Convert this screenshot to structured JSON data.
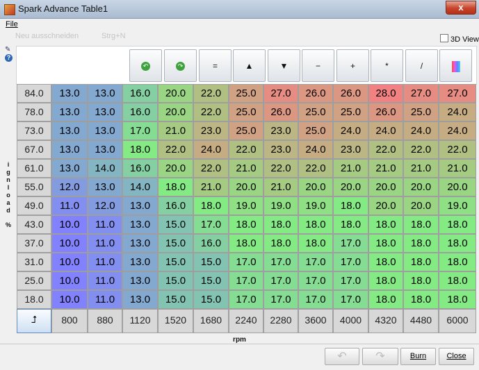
{
  "window": {
    "title": "Spark Advance Table1",
    "close_label": "x"
  },
  "menu": {
    "file": "File"
  },
  "command_bar": {
    "cut": "Neu ausschneiden",
    "cut_shortcut": "Strg+N",
    "view_3d": "3D View"
  },
  "toolbar": {
    "buttons": [
      {
        "name": "undo-icon",
        "glyph": "↶"
      },
      {
        "name": "redo-icon",
        "glyph": "↷"
      },
      {
        "name": "set-equal-icon",
        "glyph": "="
      },
      {
        "name": "increase-icon",
        "glyph": "▲"
      },
      {
        "name": "decrease-icon",
        "glyph": "▼"
      },
      {
        "name": "minus-icon",
        "glyph": "−"
      },
      {
        "name": "plus-icon",
        "glyph": "+"
      },
      {
        "name": "multiply-icon",
        "glyph": "*"
      },
      {
        "name": "interpolate-icon",
        "glyph": "/"
      },
      {
        "name": "color-palette-icon",
        "glyph": "▐"
      }
    ]
  },
  "y_axis": {
    "label_chars": [
      "i",
      "g",
      "n",
      "l",
      "o",
      "a",
      "d",
      "%"
    ]
  },
  "row_headers": [
    "84.0",
    "78.0",
    "73.0",
    "67.0",
    "61.0",
    "55.0",
    "49.0",
    "43.0",
    "37.0",
    "31.0",
    "25.0",
    "18.0"
  ],
  "col_headers": [
    "800",
    "880",
    "1120",
    "1520",
    "1680",
    "2240",
    "2280",
    "3600",
    "4000",
    "4320",
    "4480",
    "6000"
  ],
  "cells": [
    [
      "13.0",
      "13.0",
      "16.0",
      "20.0",
      "22.0",
      "25.0",
      "27.0",
      "26.0",
      "26.0",
      "28.0",
      "27.0",
      "27.0"
    ],
    [
      "13.0",
      "13.0",
      "16.0",
      "20.0",
      "22.0",
      "25.0",
      "26.0",
      "25.0",
      "25.0",
      "26.0",
      "25.0",
      "24.0"
    ],
    [
      "13.0",
      "13.0",
      "17.0",
      "21.0",
      "23.0",
      "25.0",
      "23.0",
      "25.0",
      "24.0",
      "24.0",
      "24.0",
      "24.0"
    ],
    [
      "13.0",
      "13.0",
      "18.0",
      "22.0",
      "24.0",
      "22.0",
      "23.0",
      "24.0",
      "23.0",
      "22.0",
      "22.0",
      "22.0"
    ],
    [
      "13.0",
      "14.0",
      "16.0",
      "20.0",
      "22.0",
      "21.0",
      "22.0",
      "22.0",
      "21.0",
      "21.0",
      "21.0",
      "21.0"
    ],
    [
      "12.0",
      "13.0",
      "14.0",
      "18.0",
      "21.0",
      "20.0",
      "21.0",
      "20.0",
      "20.0",
      "20.0",
      "20.0",
      "20.0"
    ],
    [
      "11.0",
      "12.0",
      "13.0",
      "16.0",
      "18.0",
      "19.0",
      "19.0",
      "19.0",
      "18.0",
      "20.0",
      "20.0",
      "19.0"
    ],
    [
      "10.0",
      "11.0",
      "13.0",
      "15.0",
      "17.0",
      "18.0",
      "18.0",
      "18.0",
      "18.0",
      "18.0",
      "18.0",
      "18.0"
    ],
    [
      "10.0",
      "11.0",
      "13.0",
      "15.0",
      "16.0",
      "18.0",
      "18.0",
      "18.0",
      "17.0",
      "18.0",
      "18.0",
      "18.0"
    ],
    [
      "10.0",
      "11.0",
      "13.0",
      "15.0",
      "15.0",
      "17.0",
      "17.0",
      "17.0",
      "17.0",
      "18.0",
      "18.0",
      "18.0"
    ],
    [
      "10.0",
      "11.0",
      "13.0",
      "15.0",
      "15.0",
      "17.0",
      "17.0",
      "17.0",
      "17.0",
      "18.0",
      "18.0",
      "18.0"
    ],
    [
      "10.0",
      "11.0",
      "13.0",
      "15.0",
      "15.0",
      "17.0",
      "17.0",
      "17.0",
      "17.0",
      "18.0",
      "18.0",
      "18.0"
    ]
  ],
  "x_axis": {
    "label": "rpm"
  },
  "buttons": {
    "undo": "↶",
    "redo": "↷",
    "burn": "Burn",
    "close": "Close"
  },
  "colors": {
    "low": "#8080ff",
    "mid": "#80e880",
    "high": "#f08080"
  }
}
